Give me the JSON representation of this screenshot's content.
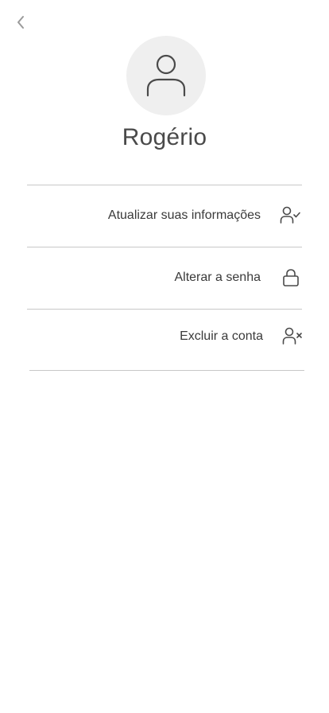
{
  "header": {
    "back_icon": "chevron-left-icon"
  },
  "profile": {
    "avatar_icon": "user-icon",
    "name": "Rogério"
  },
  "menu": {
    "items": [
      {
        "label": "Atualizar suas informações",
        "icon": "user-check-icon"
      },
      {
        "label": "Alterar a senha",
        "icon": "lock-icon"
      },
      {
        "label": "Excluir a conta",
        "icon": "user-x-icon"
      }
    ]
  },
  "colors": {
    "background": "#ffffff",
    "avatar_bg": "#efefef",
    "text": "#3a3a3a",
    "divider": "#c8c8c8",
    "icon": "#4a4a4a"
  }
}
